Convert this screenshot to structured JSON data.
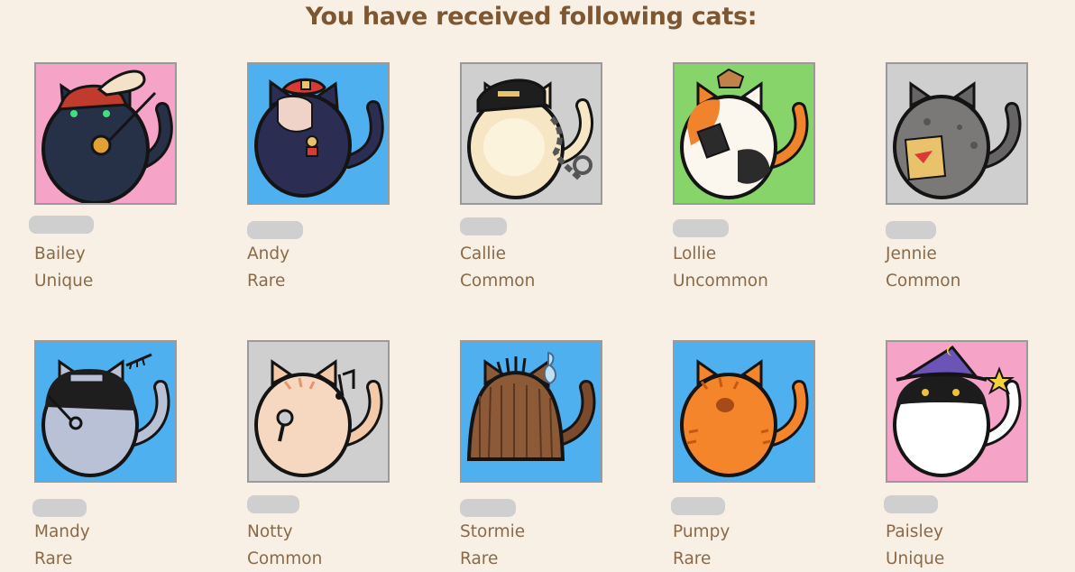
{
  "title": "You have received following cats:",
  "cats": [
    {
      "name": "Bailey",
      "rarity": "Unique",
      "bg": "#f5a3c7",
      "icon": "cat-pirate-icon"
    },
    {
      "name": "Andy",
      "rarity": "Rare",
      "bg": "#4fb0ef",
      "icon": "cat-beret-medal-icon"
    },
    {
      "name": "Callie",
      "rarity": "Common",
      "bg": "#cfcfd0",
      "icon": "cat-captain-chain-icon"
    },
    {
      "name": "Lollie",
      "rarity": "Uncommon",
      "bg": "#86d46a",
      "icon": "cat-calico-book-icon"
    },
    {
      "name": "Jennie",
      "rarity": "Common",
      "bg": "#cfcfd0",
      "icon": "cat-gray-snack-icon"
    },
    {
      "name": "Mandy",
      "rarity": "Rare",
      "bg": "#4fb0ef",
      "icon": "cat-ninja-fishbone-icon"
    },
    {
      "name": "Notty",
      "rarity": "Common",
      "bg": "#cfcfd0",
      "icon": "cat-singer-microphone-icon"
    },
    {
      "name": "Stormie",
      "rarity": "Rare",
      "bg": "#4fb0ef",
      "icon": "cat-shaggy-hair-icon"
    },
    {
      "name": "Pumpy",
      "rarity": "Rare",
      "bg": "#4fb0ef",
      "icon": "cat-orange-tabby-icon"
    },
    {
      "name": "Paisley",
      "rarity": "Unique",
      "bg": "#f5a3c7",
      "icon": "cat-wizard-hat-icon"
    }
  ]
}
